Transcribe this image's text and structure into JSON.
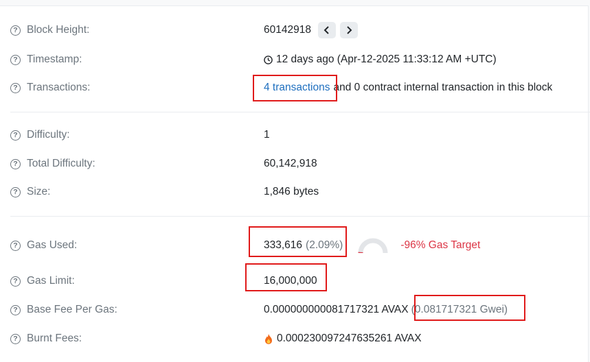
{
  "block_height": {
    "label": "Block Height:",
    "value": "60142918",
    "prev_icon": "chevron-left-icon",
    "next_icon": "chevron-right-icon"
  },
  "timestamp": {
    "label": "Timestamp:",
    "value": "12 days ago (Apr-12-2025 11:33:12 AM +UTC)",
    "icon": "clock-icon"
  },
  "transactions": {
    "label": "Transactions:",
    "link": "4 transactions",
    "rest": "and 0 contract internal transaction in this block"
  },
  "difficulty": {
    "label": "Difficulty:",
    "value": "1"
  },
  "total_difficulty": {
    "label": "Total Difficulty:",
    "value": "60,142,918"
  },
  "size": {
    "label": "Size:",
    "value": "1,846 bytes"
  },
  "gas_used": {
    "label": "Gas Used:",
    "value": "333,616",
    "percent": "(2.09%)",
    "gauge_fraction": 0.0209,
    "target": "-96% Gas Target"
  },
  "gas_limit": {
    "label": "Gas Limit:",
    "value": "16,000,000"
  },
  "base_fee": {
    "label": "Base Fee Per Gas:",
    "value": "0.000000000081717321 AVAX",
    "gwei": "(0.081717321 Gwei)"
  },
  "burnt_fees": {
    "label": "Burnt Fees:",
    "value": "0.000230097247635261 AVAX",
    "icon": "fire-icon"
  },
  "colors": {
    "link": "#1e6fbf",
    "label": "#6c757d",
    "highlight": "#e01919",
    "target": "#dc3545"
  }
}
